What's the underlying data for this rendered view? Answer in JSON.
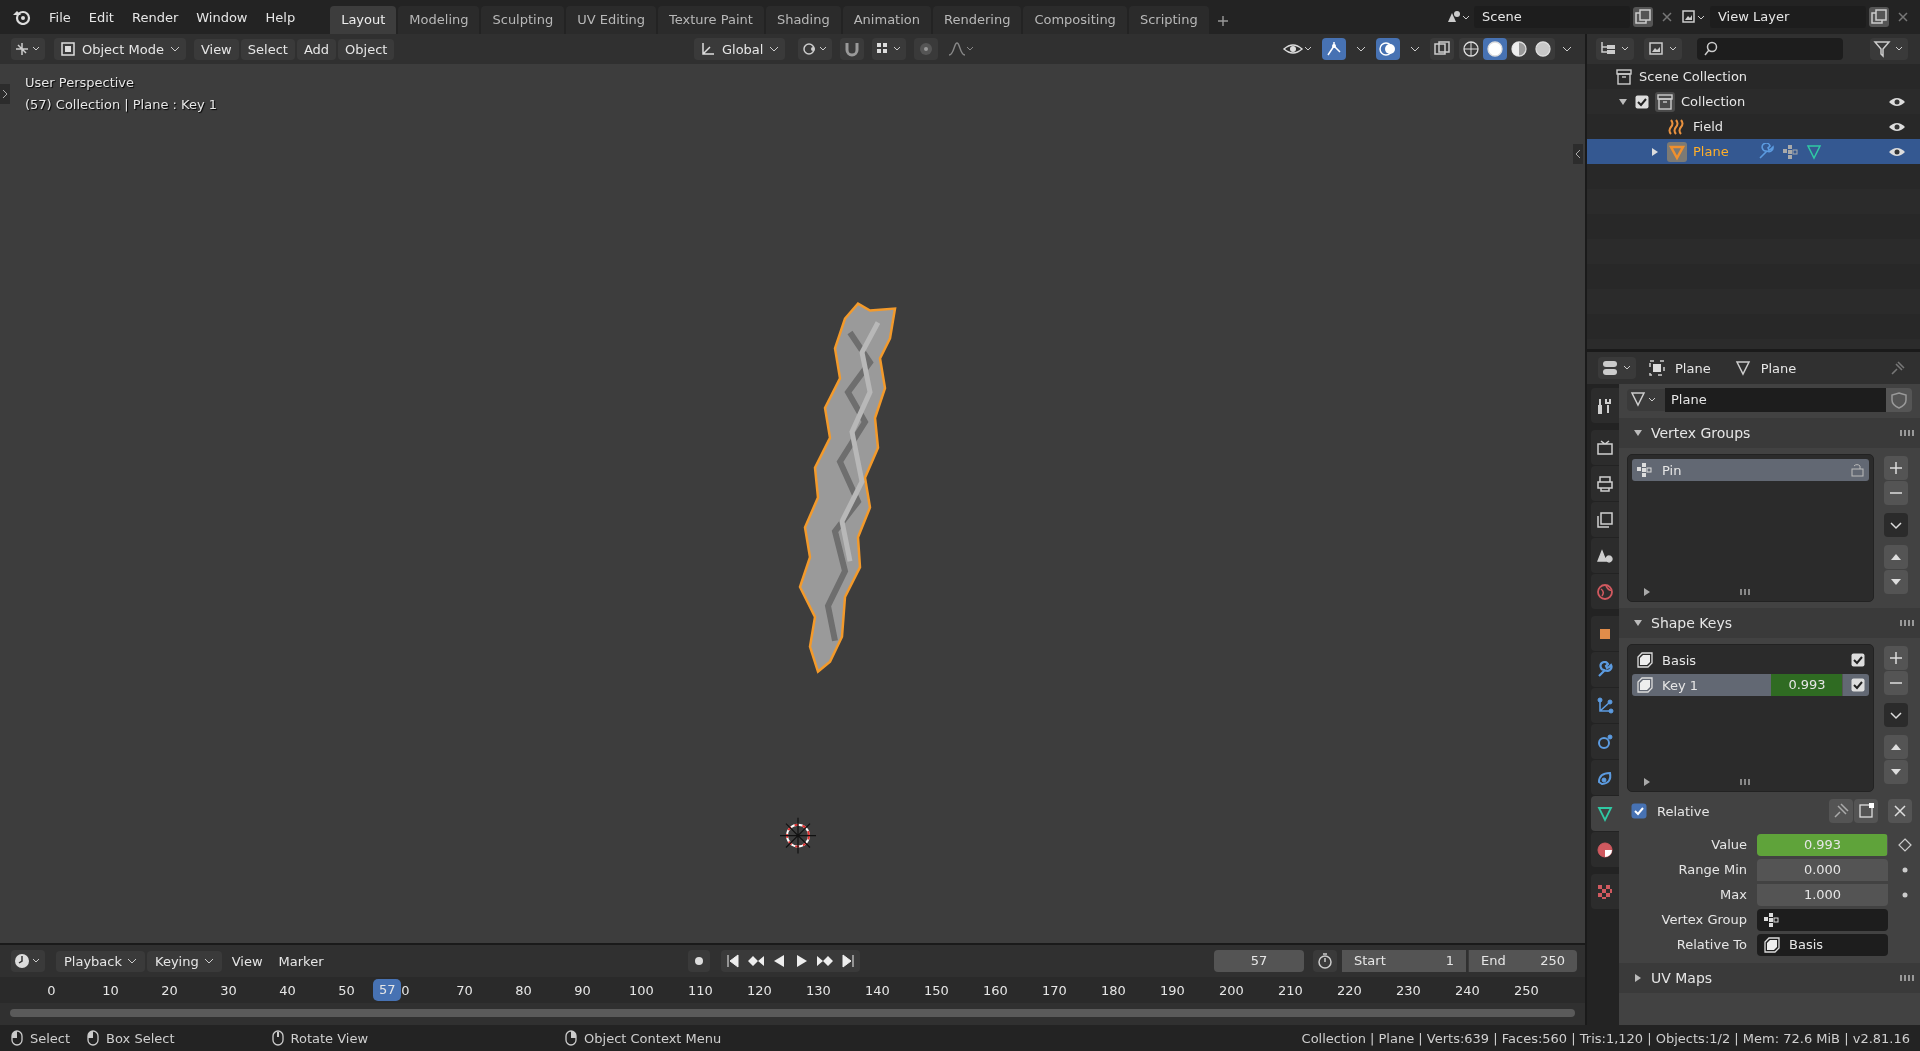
{
  "menu": [
    "File",
    "Edit",
    "Render",
    "Window",
    "Help"
  ],
  "workspaces": [
    {
      "label": "Layout",
      "selected": true
    },
    {
      "label": "Modeling",
      "selected": false
    },
    {
      "label": "Sculpting",
      "selected": false
    },
    {
      "label": "UV Editing",
      "selected": false
    },
    {
      "label": "Texture Paint",
      "selected": false
    },
    {
      "label": "Shading",
      "selected": false
    },
    {
      "label": "Animation",
      "selected": false
    },
    {
      "label": "Rendering",
      "selected": false
    },
    {
      "label": "Compositing",
      "selected": false
    },
    {
      "label": "Scripting",
      "selected": false
    }
  ],
  "scene": "Scene",
  "view_layer": "View Layer",
  "viewport_header": {
    "mode": "Object Mode",
    "menus": [
      "View",
      "Select",
      "Add",
      "Object"
    ],
    "orientation": "Global",
    "shading": [
      {
        "kind": "wireframe",
        "selected": false
      },
      {
        "kind": "solid",
        "selected": true
      },
      {
        "kind": "material",
        "selected": false
      },
      {
        "kind": "rendered",
        "selected": false
      }
    ]
  },
  "viewport": {
    "overlay": [
      "User Perspective",
      "(57) Collection | Plane : Key 1"
    ]
  },
  "outliner": {
    "root": "Scene Collection",
    "items": [
      {
        "name": "Collection",
        "kind": "collection",
        "checked": true,
        "expanded": true,
        "selected": false,
        "children": [
          {
            "name": "Field",
            "kind": "field",
            "selected": false
          },
          {
            "name": "Plane",
            "kind": "mesh",
            "expanded": false,
            "selected": true
          }
        ]
      }
    ]
  },
  "properties": {
    "breadcrumb": [
      "Plane",
      "Plane"
    ],
    "data_name": "Plane",
    "tabs": [
      {
        "kind": "tool",
        "selected": false
      },
      {
        "kind": "render",
        "selected": false
      },
      {
        "kind": "output",
        "selected": false
      },
      {
        "kind": "viewlayer",
        "selected": false
      },
      {
        "kind": "scene",
        "selected": false
      },
      {
        "kind": "world",
        "selected": false
      },
      {
        "kind": "object",
        "selected": false
      },
      {
        "kind": "modifier",
        "selected": false
      },
      {
        "kind": "particles",
        "selected": false
      },
      {
        "kind": "physics",
        "selected": false
      },
      {
        "kind": "constraints",
        "selected": false
      },
      {
        "kind": "data",
        "selected": true
      },
      {
        "kind": "material",
        "selected": false
      },
      {
        "kind": "texture",
        "selected": false
      }
    ],
    "vertex_groups": {
      "title": "Vertex Groups",
      "expanded": true,
      "items": [
        {
          "name": "Pin",
          "selected": true
        }
      ]
    },
    "shape_keys": {
      "title": "Shape Keys",
      "expanded": true,
      "items": [
        {
          "name": "Basis",
          "checked": true,
          "selected": false
        },
        {
          "name": "Key 1",
          "value": "0.993",
          "level": 0.993,
          "checked": true,
          "selected": true
        }
      ]
    },
    "relative": {
      "label": "Relative",
      "checked": true
    },
    "fields": [
      {
        "label": "Value",
        "kind": "slider",
        "value": "0.993",
        "level": 0.993
      },
      {
        "label": "Range Min",
        "kind": "number",
        "value": "0.000"
      },
      {
        "label": "Max",
        "kind": "number",
        "value": "1.000"
      },
      {
        "label": "Vertex Group",
        "kind": "vgroup"
      },
      {
        "label": "Relative To",
        "kind": "shapekey",
        "value": "Basis"
      }
    ],
    "uv_maps": {
      "title": "UV Maps",
      "expanded": false
    }
  },
  "timeline": {
    "menus": [
      "Playback",
      "Keying",
      "View",
      "Marker"
    ],
    "current_frame": "57",
    "start_label": "Start",
    "start": "1",
    "end_label": "End",
    "end": "250",
    "playhead": "57",
    "level": 0.228,
    "ticks": [
      "0",
      "10",
      "20",
      "30",
      "40",
      "50",
      "0",
      "70",
      "80",
      "90",
      "100",
      "110",
      "120",
      "130",
      "140",
      "150",
      "160",
      "170",
      "180",
      "190",
      "200",
      "210",
      "220",
      "230",
      "240",
      "250"
    ]
  },
  "status_bar": {
    "hints": [
      "Select",
      "Box Select",
      "Rotate View",
      "Object Context Menu"
    ],
    "stats": "Collection | Plane | Verts:639 | Faces:560 | Tris:1,120 | Objects:1/2 | Mem: 72.6 MiB | v2.81.16"
  }
}
